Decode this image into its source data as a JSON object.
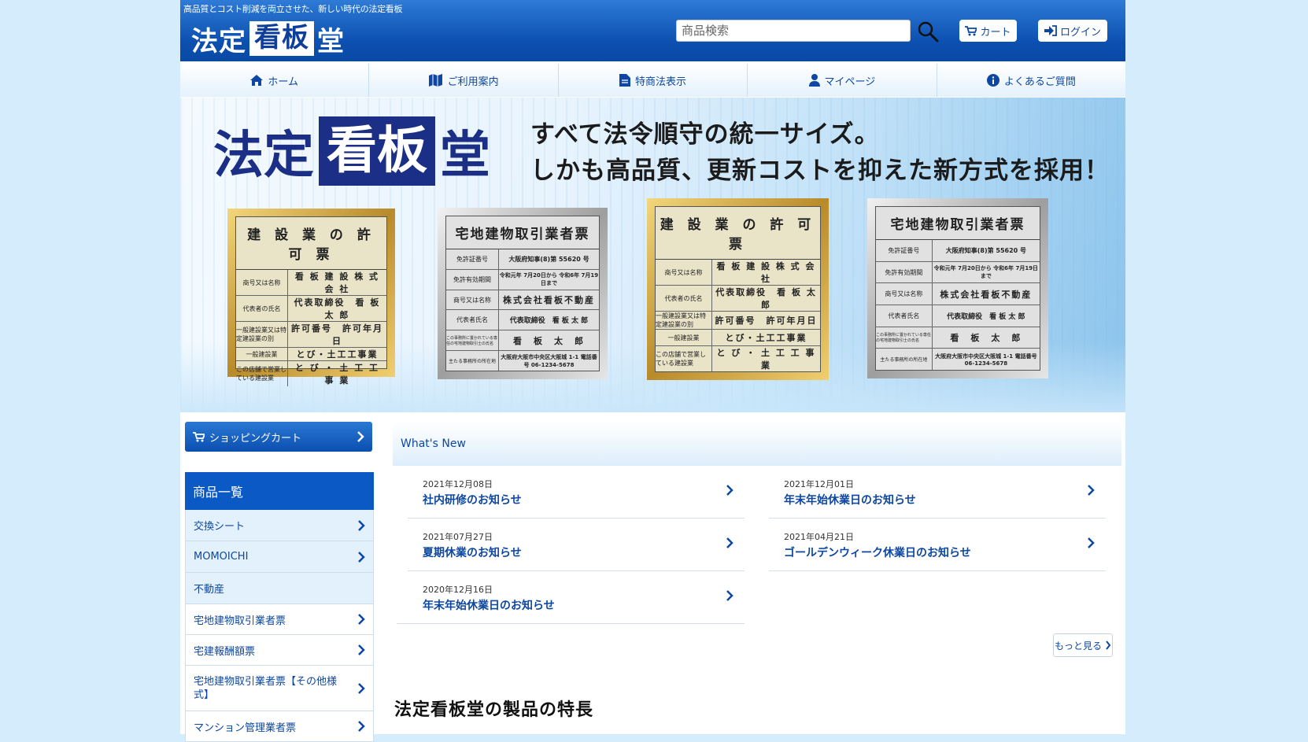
{
  "header": {
    "tagline": "高品質とコスト削減を両立させた、新しい時代の法定看板",
    "logo": {
      "left": "法定",
      "boxed": "看板",
      "right": "堂"
    },
    "search_placeholder": "商品検索",
    "cart_label": "カート",
    "login_label": "ログイン"
  },
  "nav": {
    "items": [
      {
        "label": "ホーム",
        "icon": "home-icon"
      },
      {
        "label": "ご利用案内",
        "icon": "map-icon"
      },
      {
        "label": "特商法表示",
        "icon": "document-icon"
      },
      {
        "label": "マイページ",
        "icon": "user-icon"
      },
      {
        "label": "よくあるご質問",
        "icon": "info-icon"
      }
    ]
  },
  "hero": {
    "logo": {
      "left": "法定",
      "boxed": "看板",
      "right": "堂"
    },
    "copy_line1": "すべて法令順守の統一サイズ。",
    "copy_line2": "しかも高品質、更新コストを抑えた新方式を採用！",
    "plates": [
      {
        "title": "建 設 業 の 許 可 票",
        "rows": [
          {
            "k": "商号又は名称",
            "v": "看 板 建 設 株 式 会 社"
          },
          {
            "k": "代表者の氏名",
            "v": "代表取締役　看 板 太 郎"
          },
          {
            "k": "一般建設業又は特定建設業の別",
            "v": "許可番号　許可年月日"
          },
          {
            "k": "一般建設業",
            "v": "とび・土工工事業"
          },
          {
            "k": "この店舗で営業している建設業",
            "v": "と び ・ 土 工 工 事 業"
          }
        ]
      },
      {
        "title": "宅地建物取引業者票",
        "rows": [
          {
            "k": "免許証番号",
            "v": "大阪府知事(8)第 55620 号"
          },
          {
            "k": "免許有効期間",
            "v": "令和元年 7月20日から 令和6年 7月19日まで"
          },
          {
            "k": "商号又は名称",
            "v": "株式会社看板不動産"
          },
          {
            "k": "代表者氏名",
            "v": "代表取締役　看 板 太 郎"
          },
          {
            "k": "この事務所に置かれている専任の宅地建物取引士の氏名",
            "v": "看　板　太　郎"
          },
          {
            "k": "主たる事務所の所在地",
            "v": "大阪府大阪市中央区大阪城 1-1 電話番号 06-1234-5678"
          }
        ]
      },
      {
        "title": "建 設 業 の 許 可 票",
        "rows": [
          {
            "k": "商号又は名称",
            "v": "看 板 建 設 株 式 会 社"
          },
          {
            "k": "代表者の氏名",
            "v": "代表取締役　看 板 太 郎"
          },
          {
            "k": "一般建設業又は特定建設業の別",
            "v": "許可番号　許可年月日"
          },
          {
            "k": "一般建設業",
            "v": "とび・土工工事業"
          },
          {
            "k": "この店舗で営業している建設業",
            "v": "と び ・ 土 工 工 事 業"
          }
        ]
      },
      {
        "title": "宅地建物取引業者票",
        "rows": [
          {
            "k": "免許証番号",
            "v": "大阪府知事(8)第 55620 号"
          },
          {
            "k": "免許有効期間",
            "v": "令和元年 7月20日から 令和6年 7月19日まで"
          },
          {
            "k": "商号又は名称",
            "v": "株式会社看板不動産"
          },
          {
            "k": "代表者氏名",
            "v": "代表取締役　看 板 太 郎"
          },
          {
            "k": "この事務所に置かれている専任の宅地建物取引士の氏名",
            "v": "看　板　太　郎"
          },
          {
            "k": "主たる事務所の所在地",
            "v": "大阪府大阪市中央区大阪城 1-1 電話番号 06-1234-5678"
          }
        ]
      }
    ]
  },
  "sidebar": {
    "cart_label": "ショッピングカート",
    "category_heading": "商品一覧",
    "categories": [
      {
        "label": "交換シート",
        "chevron": true,
        "type": "parent"
      },
      {
        "label": "MOMOICHI",
        "chevron": true,
        "type": "parent"
      },
      {
        "label": "不動産",
        "chevron": false,
        "type": "parent"
      },
      {
        "label": "宅地建物取引業者票",
        "chevron": true,
        "type": "sub"
      },
      {
        "label": "宅建報酬額票",
        "chevron": true,
        "type": "sub"
      },
      {
        "label": "宅地建物取引業者票【その他様式】",
        "chevron": true,
        "type": "sub"
      },
      {
        "label": "マンション管理業者票",
        "chevron": true,
        "type": "sub"
      }
    ]
  },
  "news": {
    "heading": "What's New",
    "items": [
      {
        "date": "2021年12月08日",
        "title": "社内研修のお知らせ"
      },
      {
        "date": "2021年12月01日",
        "title": "年末年始休業日のお知らせ"
      },
      {
        "date": "2021年07月27日",
        "title": "夏期休業のお知らせ"
      },
      {
        "date": "2021年04月21日",
        "title": "ゴールデンウィーク休業日のお知らせ"
      },
      {
        "date": "2020年12月16日",
        "title": "年末年始休業日のお知らせ"
      }
    ],
    "more_label": "もっと見る"
  },
  "features": {
    "heading": "法定看板堂の製品の特長"
  },
  "colors": {
    "brand": "#0b4fb0",
    "link": "#0d47a1",
    "page_bg": "#d5ecfc"
  }
}
